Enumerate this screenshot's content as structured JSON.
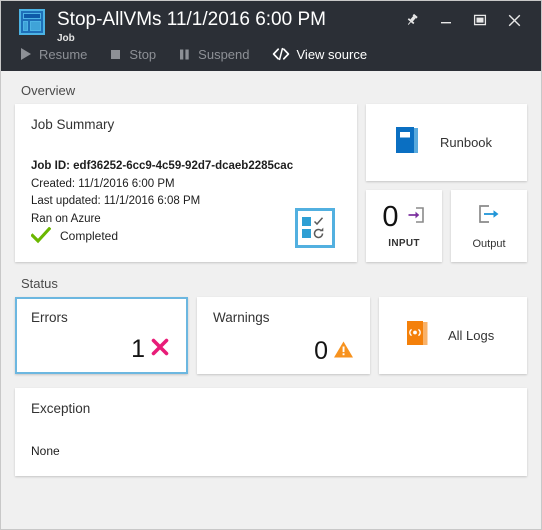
{
  "window": {
    "title": "Stop-AllVMs 11/1/2016 6:00 PM",
    "subtitle": "Job",
    "app_icon": "azure-blade-icon",
    "controls": {
      "pin": "Pin",
      "minimize": "Minimize",
      "maximize": "Maximize",
      "close": "Close"
    }
  },
  "toolbar": {
    "items": [
      {
        "label": "Resume",
        "icon": "play-icon",
        "enabled": false
      },
      {
        "label": "Stop",
        "icon": "stop-square-icon",
        "enabled": false
      },
      {
        "label": "Suspend",
        "icon": "pause-icon",
        "enabled": false
      },
      {
        "label": "View source",
        "icon": "code-brackets-icon",
        "enabled": true
      }
    ]
  },
  "overview": {
    "section_label": "Overview",
    "job_summary": {
      "title": "Job Summary",
      "job_id": "Job ID: edf36252-6cc9-4c59-92d7-dcaeb2285cac",
      "created": "Created: 11/1/2016 6:00 PM",
      "last_updated": "Last updated: 11/1/2016 6:08 PM",
      "ran_on": "Ran on Azure",
      "status": "Completed",
      "status_icon": "green-check-icon",
      "tasklist_icon": "task-checklist-icon"
    },
    "runbook": {
      "label": "Runbook",
      "icon": "blue-book-icon"
    },
    "input": {
      "count": "0",
      "label": "INPUT",
      "icon": "input-arrow-icon"
    },
    "output": {
      "label": "Output",
      "icon": "output-arrow-icon"
    }
  },
  "status": {
    "section_label": "Status",
    "errors": {
      "title": "Errors",
      "count": "1",
      "icon": "pink-x-icon",
      "selected": true
    },
    "warnings": {
      "title": "Warnings",
      "count": "0",
      "icon": "orange-warning-triangle-icon",
      "selected": false
    },
    "all_logs": {
      "label": "All Logs",
      "icon": "orange-logs-book-icon"
    }
  },
  "exception": {
    "section_label": "",
    "title": "Exception",
    "value": "None"
  },
  "colors": {
    "titlebar_bg": "#2b2f36",
    "page_bg": "#f0f0f0",
    "tile_bg": "#ffffff",
    "accent_blue": "#0078d4",
    "selection_blue": "#6cb7e0",
    "error_pink": "#e81c78",
    "warning_orange": "#f7921e",
    "success_green": "#6bb700",
    "input_purple": "#7a2f9e",
    "logs_orange": "#f4800a"
  }
}
